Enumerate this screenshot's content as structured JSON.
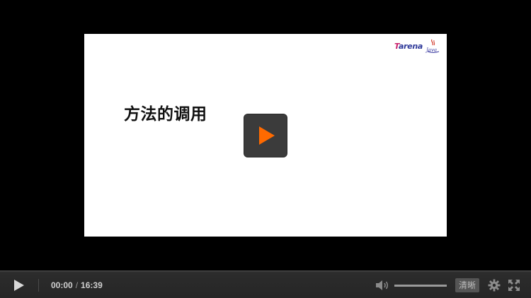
{
  "slide": {
    "title": "方法的调用",
    "logo_brand_first": "T",
    "logo_brand_rest": "arena",
    "logo_java": "Java"
  },
  "player": {
    "current_time": "00:00",
    "time_separator": "/",
    "duration": "16:39",
    "quality_label": "清晰",
    "volume_level": 1.0
  },
  "icons": {
    "big_play": "play-icon",
    "play": "play-icon",
    "volume": "volume-icon",
    "settings": "gear-icon",
    "fullscreen": "fullscreen-icon"
  },
  "colors": {
    "play_accent": "#ff6a00",
    "control_bar": "#262626",
    "quality_bg": "#555555"
  }
}
